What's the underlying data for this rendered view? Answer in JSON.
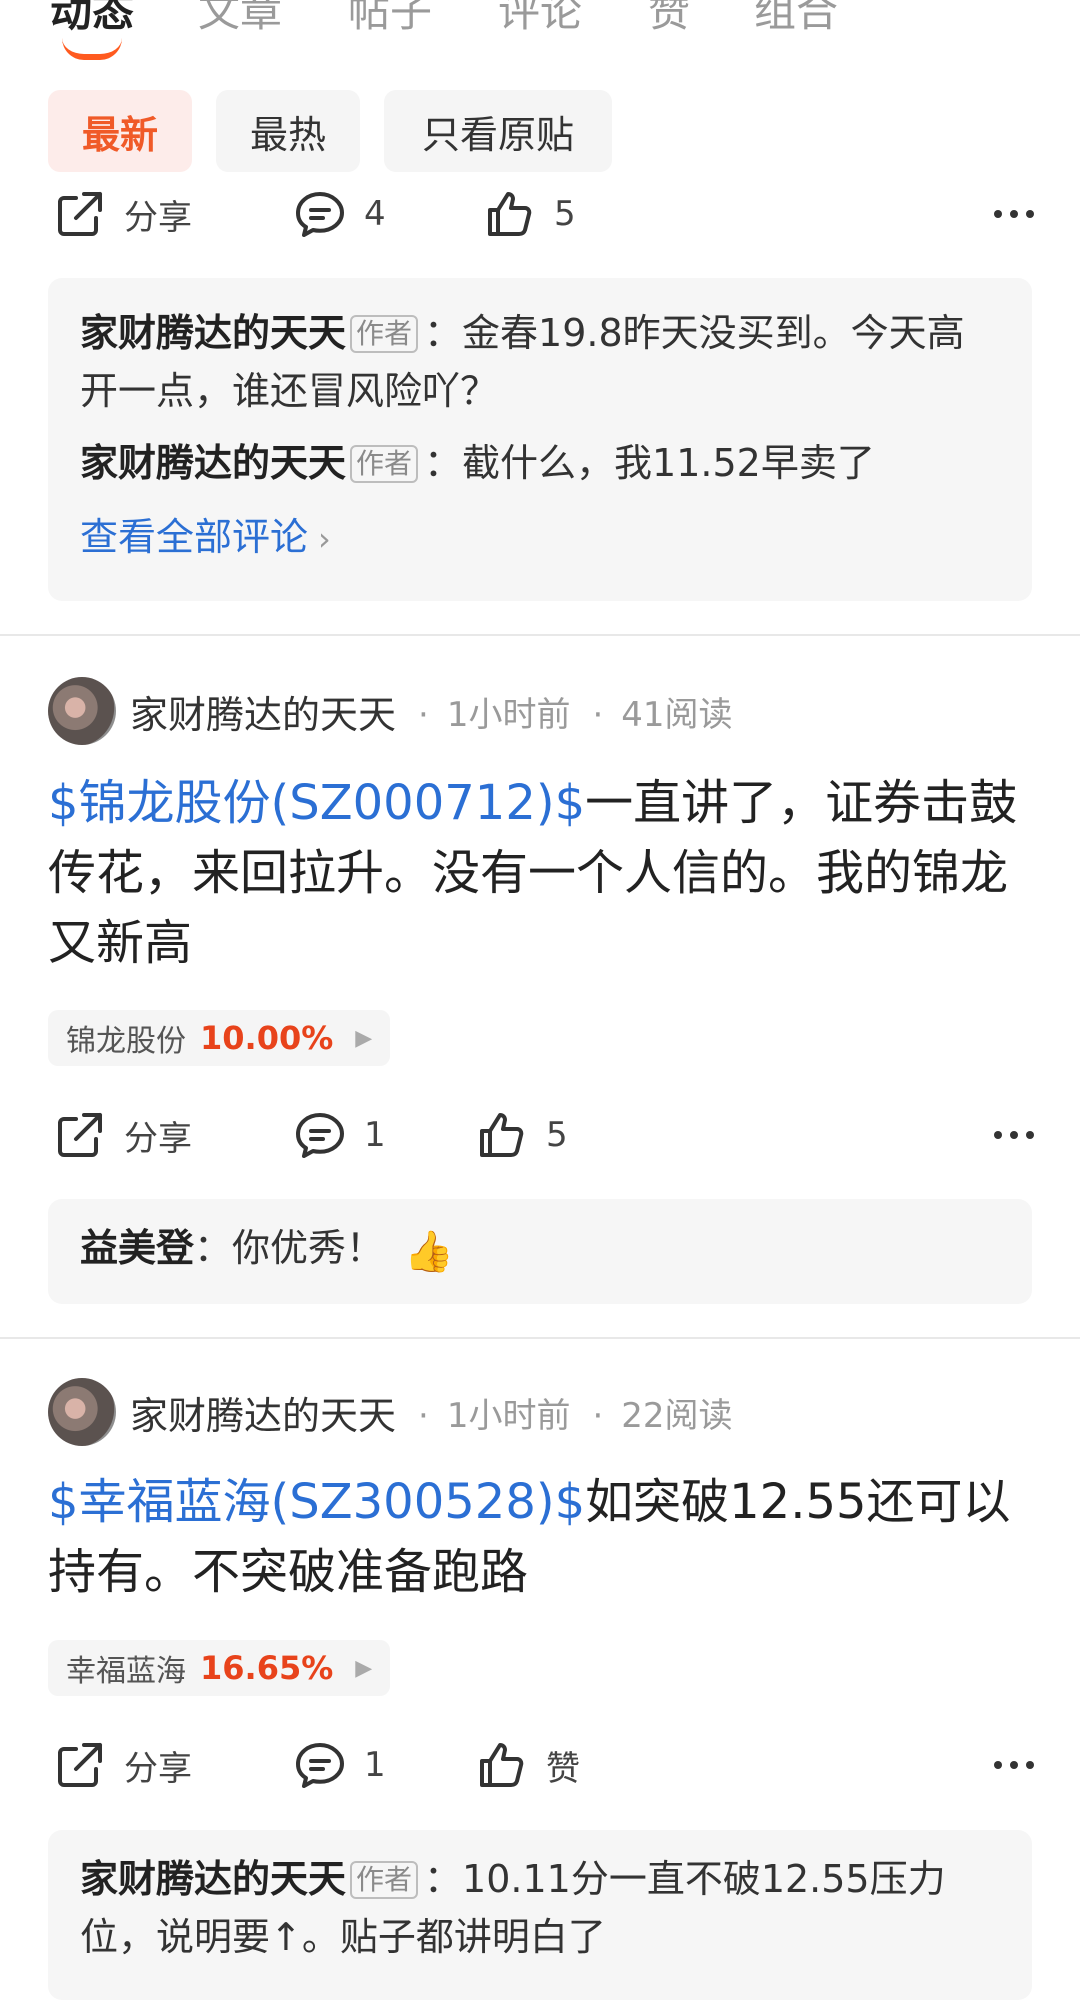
{
  "tabs": [
    "动态",
    "文章",
    "帖子",
    "评论",
    "赞",
    "组合"
  ],
  "filters": [
    "最新",
    "最热",
    "只看原贴"
  ],
  "common": {
    "share": "分享",
    "author_badge": "作者",
    "see_all": "查看全部评论"
  },
  "post0": {
    "comments": "4",
    "likes": "5",
    "replies": [
      {
        "user": "家财腾达的天天",
        "text": "：金春19.8昨天没买到。今天高开一点，谁还冒风险吖？"
      },
      {
        "user": "家财腾达的天天",
        "text": "：截什么，我11.52早卖了"
      }
    ]
  },
  "post1": {
    "user": "家财腾达的天天",
    "time": "1小时前",
    "reads": "41阅读",
    "stock_link": "$锦龙股份(SZ000712)$",
    "text": "一直讲了，证券击鼓传花，来回拉升。没有一个人信的。我的锦龙又新高",
    "tag_name": "锦龙股份",
    "tag_pct": "10.00%",
    "comments": "1",
    "likes": "5",
    "reply_user": "益美登",
    "reply_text": "：你优秀！",
    "reply_emoji": "👍"
  },
  "post2": {
    "user": "家财腾达的天天",
    "time": "1小时前",
    "reads": "22阅读",
    "stock_link": "$幸福蓝海(SZ300528)$",
    "text": "如突破12.55还可以持有。不突破准备跑路",
    "tag_name": "幸福蓝海",
    "tag_pct": "16.65%",
    "comments": "1",
    "likes": "赞",
    "reply_user": "家财腾达的天天",
    "reply_text": "：10.11分一直不破12.55压力位，说明要↑。贴子都讲明白了"
  }
}
